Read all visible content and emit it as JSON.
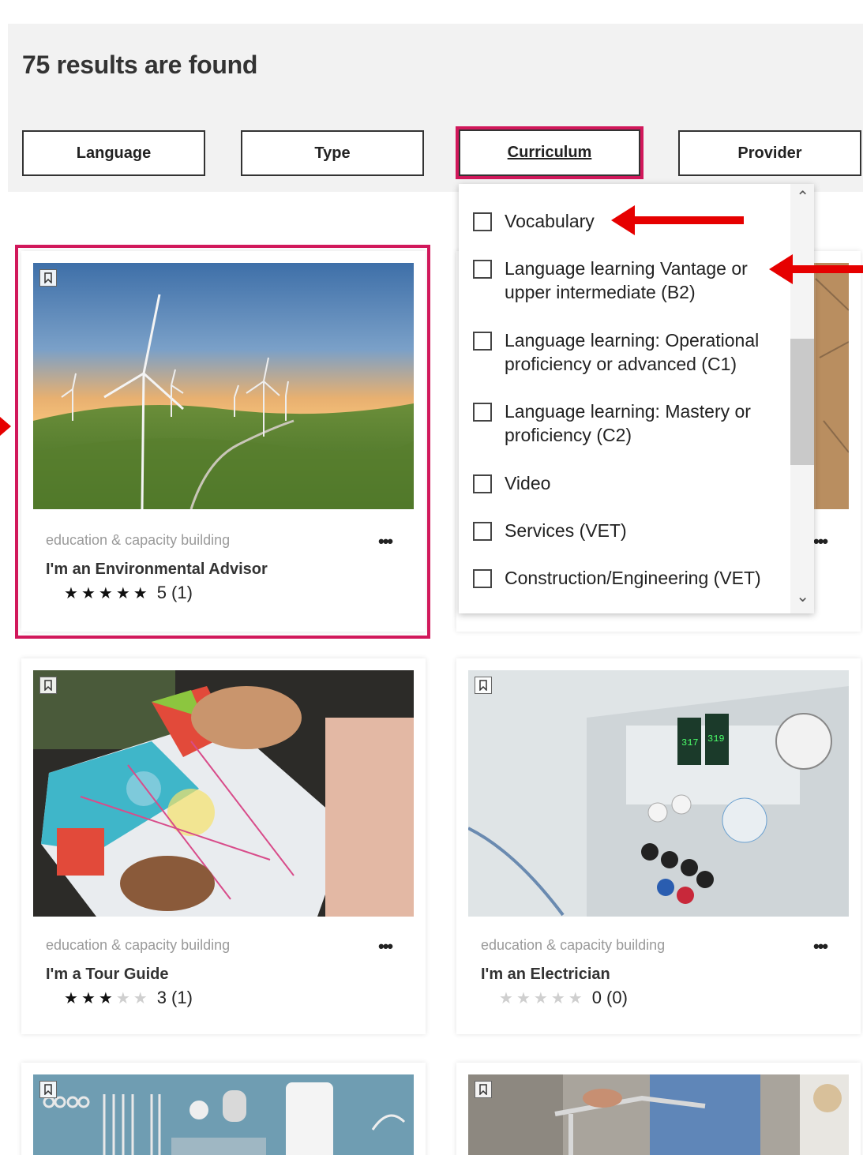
{
  "results": {
    "title": "75 results are found"
  },
  "filters": [
    {
      "label": "Language"
    },
    {
      "label": "Type"
    },
    {
      "label": "Curriculum"
    },
    {
      "label": "Provider"
    }
  ],
  "curriculum_dropdown": {
    "items": [
      {
        "label": "Vocabulary"
      },
      {
        "label": "Language learning Vantage or",
        "label2": "upper intermediate (B2)"
      },
      {
        "label": "Language learning: Operational",
        "label2": "proficiency or advanced (C1)"
      },
      {
        "label": "Language learning: Mastery or",
        "label2": "proficiency (C2)"
      },
      {
        "label": "Video"
      },
      {
        "label": "Services (VET)"
      },
      {
        "label": "Construction/Engineering (VET)"
      }
    ],
    "scroll_up_icon": "chevron-up-icon",
    "scroll_down_icon": "chevron-down-icon"
  },
  "cards": [
    {
      "category": "education & capacity building",
      "title": "I'm an Environmental Advisor",
      "stars": 5,
      "rating_text": "5 (1)",
      "image": "wind-turbines"
    },
    {
      "category": "education & capacity building",
      "title": "I'm a Tour Guide",
      "stars": 3,
      "rating_text": "3 (1)",
      "image": "city-map"
    },
    {
      "category": "education & capacity building",
      "title": "I'm an Electrician",
      "stars": 0,
      "rating_text": "0 (0)",
      "image": "power-supply"
    },
    {
      "image": "surgical-instruments"
    },
    {
      "image": "hospital-walker"
    }
  ],
  "more_icon_label": "•••",
  "colors": {
    "highlight": "#d1185b",
    "arrow": "#e60000",
    "band": "#f2f2f2"
  }
}
